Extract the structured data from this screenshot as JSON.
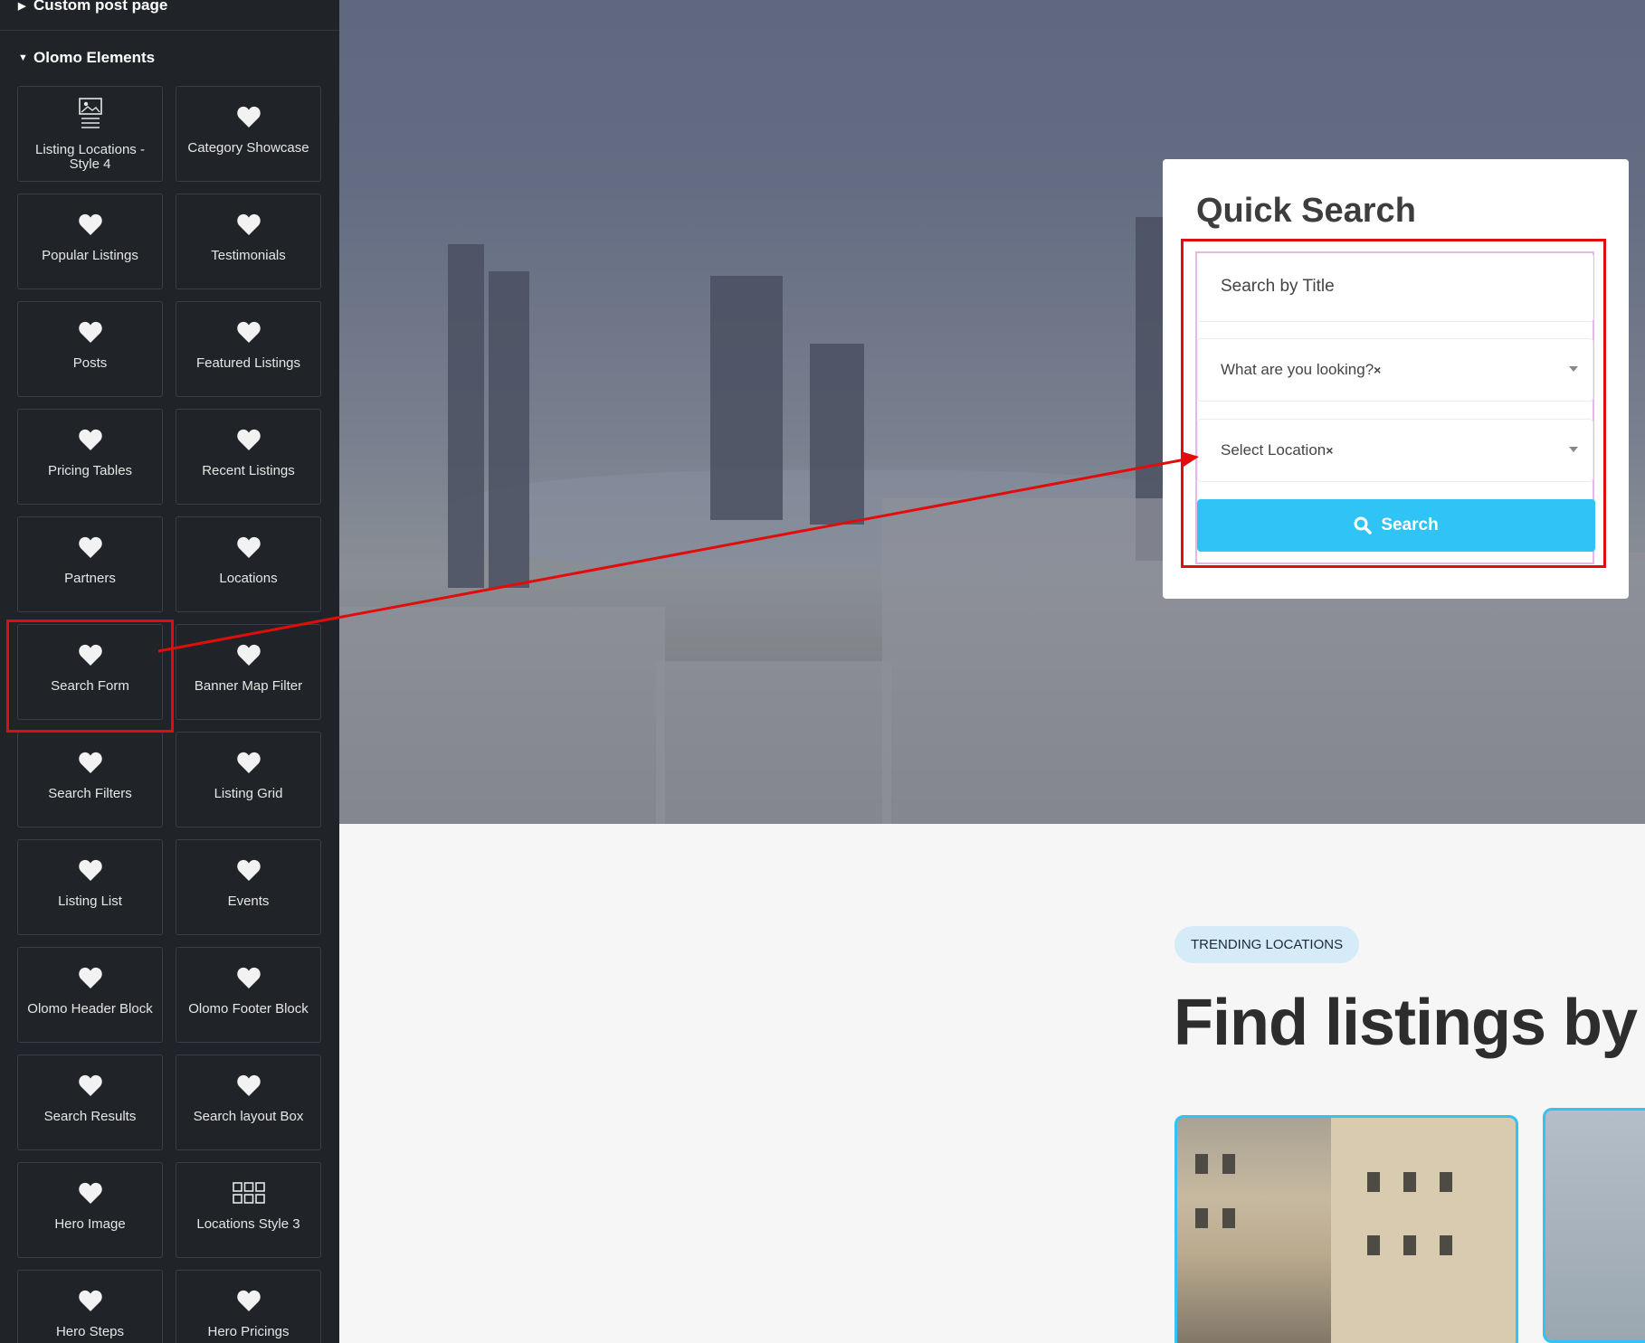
{
  "sidebar": {
    "categories": {
      "custom_post_page": "Custom post page",
      "olomo_elements": "Olomo Elements"
    },
    "collapse_glyph": "‹",
    "widgets": [
      {
        "label": "Listing Locations - Style 4",
        "icon": "image-list-icon"
      },
      {
        "label": "Category Showcase",
        "icon": "heart-icon"
      },
      {
        "label": "Popular Listings",
        "icon": "heart-icon"
      },
      {
        "label": "Testimonials",
        "icon": "heart-icon"
      },
      {
        "label": "Posts",
        "icon": "heart-icon"
      },
      {
        "label": "Featured Listings",
        "icon": "heart-icon"
      },
      {
        "label": "Pricing Tables",
        "icon": "heart-icon"
      },
      {
        "label": "Recent Listings",
        "icon": "heart-icon"
      },
      {
        "label": "Partners",
        "icon": "heart-icon"
      },
      {
        "label": "Locations",
        "icon": "heart-icon"
      },
      {
        "label": "Search Form",
        "icon": "heart-icon"
      },
      {
        "label": "Banner Map Filter",
        "icon": "heart-icon"
      },
      {
        "label": "Search Filters",
        "icon": "heart-icon"
      },
      {
        "label": "Listing Grid",
        "icon": "heart-icon"
      },
      {
        "label": "Listing List",
        "icon": "heart-icon"
      },
      {
        "label": "Events",
        "icon": "heart-icon"
      },
      {
        "label": "Olomo Header Block",
        "icon": "heart-icon"
      },
      {
        "label": "Olomo Footer Block",
        "icon": "heart-icon"
      },
      {
        "label": "Search Results",
        "icon": "heart-icon"
      },
      {
        "label": "Search layout Box",
        "icon": "heart-icon"
      },
      {
        "label": "Hero Image",
        "icon": "heart-icon"
      },
      {
        "label": "Locations Style 3",
        "icon": "grid-icon"
      },
      {
        "label": "Hero Steps",
        "icon": "heart-icon"
      },
      {
        "label": "Hero Pricings",
        "icon": "heart-icon"
      }
    ]
  },
  "quick_search": {
    "title": "Quick Search",
    "title_placeholder": "Search by Title",
    "category_select": {
      "value": "What are you looking?",
      "clear": "×"
    },
    "location_select": {
      "value": "Select Location",
      "clear": "×"
    },
    "button_label": "Search"
  },
  "trending": {
    "badge": "TRENDING LOCATIONS",
    "heading": "Find listings by l"
  },
  "colors": {
    "sidebar_bg": "#202328",
    "accent": "#2fc4f5",
    "annotation_red": "#e00d0d",
    "badge_bg": "#d5ecf8"
  }
}
